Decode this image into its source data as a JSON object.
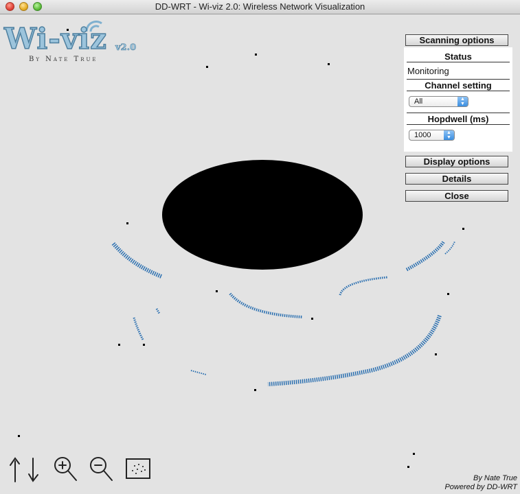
{
  "window": {
    "title": "DD-WRT - Wi-viz 2.0: Wireless Network Visualization"
  },
  "logo": {
    "name": "Wi-viz",
    "version": "v2.0",
    "byline": "By Nate True"
  },
  "panel": {
    "scanning_options": "Scanning options",
    "status_header": "Status",
    "status_value": "Monitoring",
    "channel_header": "Channel setting",
    "channel_value": "All",
    "hopdwell_header": "Hopdwell (ms)",
    "hopdwell_value": "1000",
    "display_options": "Display options",
    "details": "Details",
    "close": "Close"
  },
  "credits": {
    "line1": "By Nate True",
    "line2": "Powered by DD-WRT"
  },
  "toolbar": {
    "icons": [
      "rotate-up-icon",
      "rotate-down-icon",
      "zoom-in-icon",
      "zoom-out-icon",
      "scatter-view-icon"
    ]
  },
  "colors": {
    "ring": "#2a6fb0",
    "hub": "#000000",
    "node": "#000000"
  }
}
